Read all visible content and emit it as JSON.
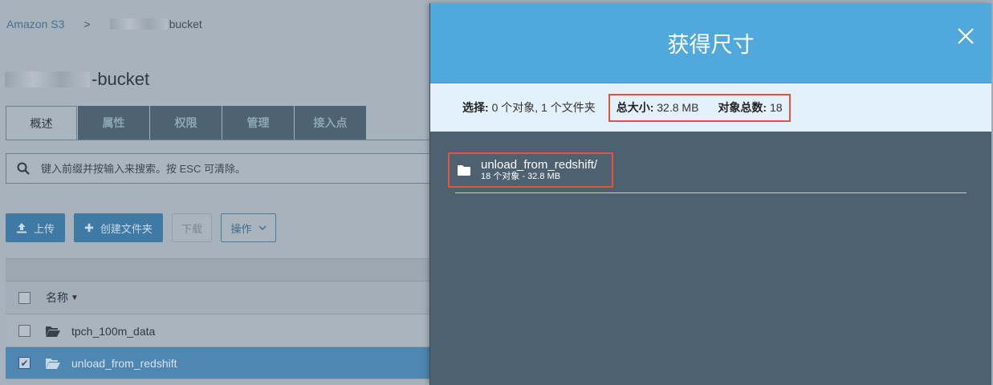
{
  "breadcrumb": {
    "root": "Amazon S3",
    "separator": ">",
    "bucket_suffix": "bucket"
  },
  "bucket": {
    "title_suffix": "-bucket"
  },
  "tabs": [
    {
      "label": "概述",
      "active": true
    },
    {
      "label": "属性",
      "active": false
    },
    {
      "label": "权限",
      "active": false
    },
    {
      "label": "管理",
      "active": false
    },
    {
      "label": "接入点",
      "active": false
    }
  ],
  "search": {
    "placeholder": "键入前缀并按输入来搜索。按 ESC 可清除。"
  },
  "toolbar": {
    "upload_label": "上传",
    "create_folder_label": "创建文件夹",
    "download_label": "下载",
    "actions_label": "操作"
  },
  "table": {
    "header_name": "名称",
    "rows": [
      {
        "name": "tpch_100m_data",
        "selected": false
      },
      {
        "name": "unload_from_redshift",
        "selected": true
      }
    ]
  },
  "modal": {
    "title": "获得尺寸",
    "summary": {
      "selection_label": "选择:",
      "selection_value": "0 个对象, 1 个文件夹",
      "total_size_label": "总大小:",
      "total_size_value": "32.8 MB",
      "total_objects_label": "对象总数:",
      "total_objects_value": "18"
    },
    "folder": {
      "name": "unload_from_redshift/",
      "meta": "18 个对象 - 32.8 MB"
    }
  },
  "colors": {
    "modal_header": "#51a8dd",
    "summary_bg": "#e2f1fb",
    "modal_body": "#4d6170",
    "highlight": "#e2533a",
    "selected_row": "#4e87b2"
  }
}
